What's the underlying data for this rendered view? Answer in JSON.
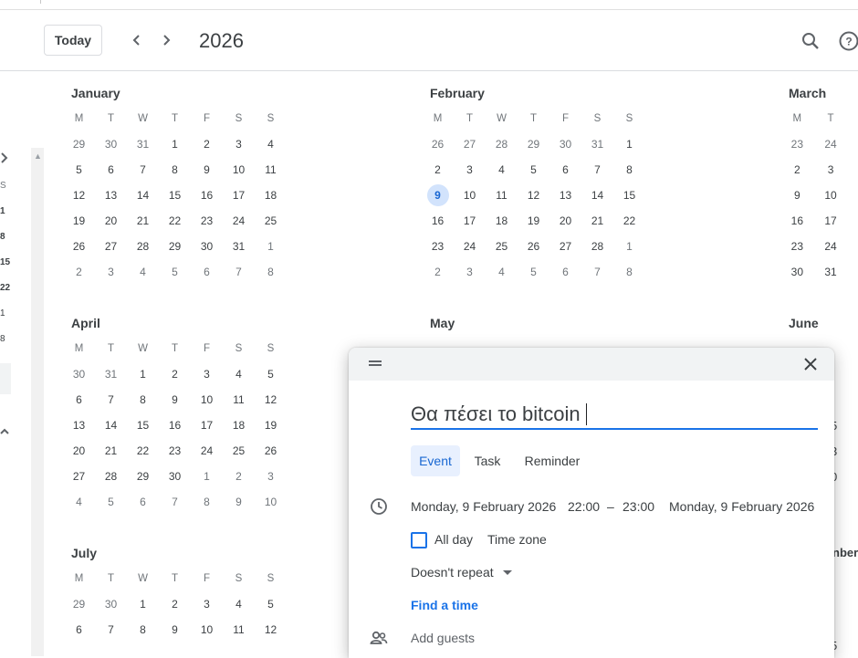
{
  "header": {
    "today_label": "Today",
    "year": "2026"
  },
  "sidebar": {
    "mini_numbers": [
      "S",
      "1",
      "8",
      "15",
      "22",
      "1",
      "8"
    ]
  },
  "months": [
    {
      "name": "January",
      "dow": [
        "M",
        "T",
        "W",
        "T",
        "F",
        "S",
        "S"
      ],
      "weeks": [
        [
          "29",
          "30",
          "31",
          "1",
          "2",
          "3",
          "4"
        ],
        [
          "5",
          "6",
          "7",
          "8",
          "9",
          "10",
          "11"
        ],
        [
          "12",
          "13",
          "14",
          "15",
          "16",
          "17",
          "18"
        ],
        [
          "19",
          "20",
          "21",
          "22",
          "23",
          "24",
          "25"
        ],
        [
          "26",
          "27",
          "28",
          "29",
          "30",
          "31",
          "1"
        ],
        [
          "2",
          "3",
          "4",
          "5",
          "6",
          "7",
          "8"
        ]
      ],
      "out": [
        [
          0,
          0
        ],
        [
          0,
          1
        ],
        [
          0,
          2
        ],
        [
          4,
          6
        ],
        [
          5,
          0
        ],
        [
          5,
          1
        ],
        [
          5,
          2
        ],
        [
          5,
          3
        ],
        [
          5,
          4
        ],
        [
          5,
          5
        ],
        [
          5,
          6
        ]
      ]
    },
    {
      "name": "February",
      "dow": [
        "M",
        "T",
        "W",
        "T",
        "F",
        "S",
        "S"
      ],
      "weeks": [
        [
          "26",
          "27",
          "28",
          "29",
          "30",
          "31",
          "1"
        ],
        [
          "2",
          "3",
          "4",
          "5",
          "6",
          "7",
          "8"
        ],
        [
          "9",
          "10",
          "11",
          "12",
          "13",
          "14",
          "15"
        ],
        [
          "16",
          "17",
          "18",
          "19",
          "20",
          "21",
          "22"
        ],
        [
          "23",
          "24",
          "25",
          "26",
          "27",
          "28",
          "1"
        ],
        [
          "2",
          "3",
          "4",
          "5",
          "6",
          "7",
          "8"
        ]
      ],
      "out": [
        [
          0,
          0
        ],
        [
          0,
          1
        ],
        [
          0,
          2
        ],
        [
          0,
          3
        ],
        [
          0,
          4
        ],
        [
          0,
          5
        ],
        [
          4,
          6
        ],
        [
          5,
          0
        ],
        [
          5,
          1
        ],
        [
          5,
          2
        ],
        [
          5,
          3
        ],
        [
          5,
          4
        ],
        [
          5,
          5
        ],
        [
          5,
          6
        ]
      ],
      "selected": [
        2,
        0
      ]
    },
    {
      "name": "March",
      "dow": [
        "M",
        "T"
      ],
      "weeks": [
        [
          "23",
          "24"
        ],
        [
          "2",
          "3"
        ],
        [
          "9",
          "10"
        ],
        [
          "16",
          "17"
        ],
        [
          "23",
          "24"
        ],
        [
          "30",
          "31"
        ]
      ],
      "out": [
        [
          0,
          0
        ],
        [
          0,
          1
        ]
      ]
    },
    {
      "name": "April",
      "dow": [
        "M",
        "T",
        "W",
        "T",
        "F",
        "S",
        "S"
      ],
      "weeks": [
        [
          "30",
          "31",
          "1",
          "2",
          "3",
          "4",
          "5"
        ],
        [
          "6",
          "7",
          "8",
          "9",
          "10",
          "11",
          "12"
        ],
        [
          "13",
          "14",
          "15",
          "16",
          "17",
          "18",
          "19"
        ],
        [
          "20",
          "21",
          "22",
          "23",
          "24",
          "25",
          "26"
        ],
        [
          "27",
          "28",
          "29",
          "30",
          "1",
          "2",
          "3"
        ],
        [
          "4",
          "5",
          "6",
          "7",
          "8",
          "9",
          "10"
        ]
      ],
      "out": [
        [
          0,
          0
        ],
        [
          0,
          1
        ],
        [
          4,
          4
        ],
        [
          4,
          5
        ],
        [
          4,
          6
        ],
        [
          5,
          0
        ],
        [
          5,
          1
        ],
        [
          5,
          2
        ],
        [
          5,
          3
        ],
        [
          5,
          4
        ],
        [
          5,
          5
        ],
        [
          5,
          6
        ]
      ]
    },
    {
      "name": "May",
      "dow": [],
      "weeks": [],
      "out": []
    },
    {
      "name": "June",
      "dow": [],
      "weeks": [],
      "out": []
    },
    {
      "name": "July",
      "dow": [
        "M",
        "T",
        "W",
        "T",
        "F",
        "S",
        "S"
      ],
      "weeks": [
        [
          "29",
          "30",
          "1",
          "2",
          "3",
          "4",
          "5"
        ],
        [
          "6",
          "7",
          "8",
          "9",
          "10",
          "11",
          "12"
        ]
      ],
      "out": [
        [
          0,
          0
        ],
        [
          0,
          1
        ]
      ]
    }
  ],
  "right_edge_fragments": [
    "5",
    "3",
    "0",
    "nber",
    "5"
  ],
  "dialog": {
    "title_value": "Θα πέσει το bitcoin",
    "tabs": [
      "Event",
      "Task",
      "Reminder"
    ],
    "start_date": "Monday, 9 February 2026",
    "start_time": "22:00",
    "dash": "–",
    "end_time": "23:00",
    "end_date": "Monday, 9 February 2026",
    "all_day": "All day",
    "time_zone": "Time zone",
    "repeat": "Doesn't repeat",
    "find_time": "Find a time",
    "add_guests": "Add guests"
  },
  "colors": {
    "accent": "#1a73e8",
    "selected_day_bg": "#d2e3fc"
  }
}
